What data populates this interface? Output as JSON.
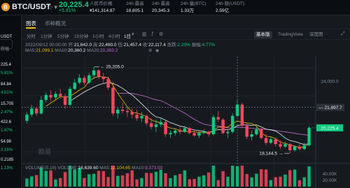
{
  "header": {
    "pair": "BTC/USDT",
    "pair_icon": "B",
    "price": "20,225.4",
    "change": "+5.81%",
    "stats": [
      {
        "label": "人民币价格",
        "value": "¥141,314.87"
      },
      {
        "label": "24h 最高",
        "value": "18,805.1"
      },
      {
        "label": "24h 最高",
        "value": "20,345.3"
      },
      {
        "label": "24h 量(BTC)",
        "value": "1.33万"
      },
      {
        "label": "24h 额(USDT)",
        "value": "2.59亿"
      }
    ]
  },
  "left_panel": {
    "items": [
      {
        "text": "USDT",
        "color": "#eaecef"
      },
      {
        "text": "跌幅",
        "color": "#848e9c"
      },
      {
        "text": "225.4",
        "color": "#eaecef"
      },
      {
        "text": "5.81%",
        "color": "#0ecb81"
      },
      {
        "text": "84.84",
        "color": "#eaecef"
      },
      {
        "text": "4.51%",
        "color": "#0ecb81"
      },
      {
        "text": "15.705",
        "color": "#eaecef"
      },
      {
        "text": "2.47%",
        "color": "#0ecb81"
      },
      {
        "text": "422.6",
        "color": "#eaecef"
      },
      {
        "text": "1.87%",
        "color": "#0ecb81"
      },
      {
        "text": "54.98",
        "color": "#eaecef"
      },
      {
        "text": "2.15%",
        "color": "#0ecb81"
      },
      {
        "text": "0.2185",
        "color": "#eaecef"
      },
      {
        "text": "1.13%",
        "color": "#0ecb81"
      }
    ]
  },
  "tabs": {
    "chart": "图表",
    "overview": "币种概况"
  },
  "toolbar": {
    "intervals": [
      "分时",
      "1分钟",
      "5分钟",
      "15分钟",
      "1小时",
      "4小时",
      "1日"
    ],
    "selected": "1日",
    "views": [
      "基本版",
      "TradingView",
      "深度图"
    ],
    "selected_view": "基本版"
  },
  "ohlc": {
    "date": "2022/09/12 00:00:00",
    "open_label": "开:",
    "open": "21,642.0",
    "high_label": "高:",
    "high": "22,490.0",
    "low_label": "低:",
    "low": "21,457.4",
    "close_label": "收:",
    "close": "22,117.4",
    "change_label": "涨跌:",
    "change": "2.20%",
    "amp_label": "振幅:",
    "amp": "4.77%"
  },
  "ma": {
    "ma5_label": "MA5:",
    "ma5": "21,099.1",
    "ma10_label": "MA10:",
    "ma10": "20,360.2",
    "ma20_label": "MA20:",
    "ma20": "20,393.2"
  },
  "volume_info": {
    "label": "VOLUME(5,10)",
    "vol_label": "VOLUME:",
    "vol": "16,639.60",
    "ma5_label": "MA5:",
    "ma5": "12,104.65",
    "ma10_label": "MA10:",
    "ma10": "9,373.50"
  },
  "price_axis": {
    "top": "24,000.0",
    "cross": "21,897.7",
    "current": "20,225.4",
    "vol1": "40.00K",
    "vol2": "20.00K"
  },
  "annotations": {
    "high": "25,205.0",
    "low": "18,144.5"
  },
  "watermark": "欧易",
  "colors": {
    "up": "#0ecb81",
    "down": "#f6465d",
    "ma5": "#f0b90b",
    "ma10": "#eaecef",
    "ma20": "#c86ad8"
  },
  "chart_data": {
    "type": "candlestick",
    "candles": [
      [
        20800,
        21500,
        20600,
        21300
      ],
      [
        21300,
        22100,
        21100,
        21800
      ],
      [
        21800,
        21900,
        21200,
        21400
      ],
      [
        21400,
        22800,
        21300,
        22500
      ],
      [
        22500,
        23100,
        22300,
        22900
      ],
      [
        22900,
        23300,
        22400,
        22700
      ],
      [
        22700,
        23200,
        22500,
        23000
      ],
      [
        23000,
        23400,
        22600,
        22800
      ],
      [
        22800,
        23000,
        21800,
        22100
      ],
      [
        22100,
        23600,
        22000,
        23400
      ],
      [
        23400,
        24200,
        23300,
        23900
      ],
      [
        23900,
        24600,
        23800,
        24300
      ],
      [
        24300,
        24500,
        23700,
        23900
      ],
      [
        23900,
        24700,
        23800,
        24500
      ],
      [
        24500,
        25205,
        24200,
        24900
      ],
      [
        24900,
        25000,
        24200,
        24400
      ],
      [
        24400,
        24700,
        23900,
        24200
      ],
      [
        24200,
        24400,
        23300,
        23500
      ],
      [
        23500,
        24000,
        21200,
        21400
      ],
      [
        21400,
        21900,
        21000,
        21700
      ],
      [
        21700,
        22300,
        21400,
        21600
      ],
      [
        21600,
        21900,
        21100,
        21500
      ],
      [
        21500,
        21800,
        21000,
        21300
      ],
      [
        21300,
        21700,
        20800,
        21000
      ],
      [
        21000,
        21500,
        20700,
        21200
      ],
      [
        21200,
        21300,
        20400,
        20600
      ],
      [
        20600,
        21000,
        20100,
        20300
      ],
      [
        20300,
        20900,
        19900,
        20500
      ],
      [
        20500,
        21000,
        20300,
        20700
      ],
      [
        20700,
        20800,
        19500,
        19700
      ],
      [
        19700,
        20000,
        19400,
        19800
      ],
      [
        19800,
        20200,
        19600,
        20000
      ],
      [
        20000,
        20300,
        19700,
        19900
      ],
      [
        19900,
        20400,
        19800,
        20200
      ],
      [
        20200,
        20300,
        19700,
        19800
      ],
      [
        19800,
        20100,
        19500,
        19600
      ],
      [
        19600,
        20000,
        19400,
        19800
      ],
      [
        19800,
        20100,
        19700,
        19900
      ],
      [
        19900,
        20000,
        19500,
        19700
      ],
      [
        19700,
        21300,
        19600,
        21100
      ],
      [
        21100,
        21600,
        20700,
        20900
      ],
      [
        20900,
        21000,
        19700,
        19800
      ],
      [
        19800,
        20100,
        19400,
        19900
      ],
      [
        19900,
        21400,
        19800,
        21200
      ],
      [
        21200,
        22490,
        21100,
        22117
      ],
      [
        22117,
        22300,
        20200,
        20400
      ],
      [
        20400,
        20600,
        19300,
        19500
      ],
      [
        19500,
        20000,
        19200,
        19700
      ],
      [
        19700,
        20300,
        19600,
        20100
      ],
      [
        20100,
        20200,
        19300,
        19400
      ],
      [
        19400,
        19700,
        18800,
        19000
      ],
      [
        19000,
        19500,
        18900,
        19300
      ],
      [
        19300,
        19400,
        18700,
        18900
      ],
      [
        18900,
        19200,
        18500,
        18700
      ],
      [
        18700,
        19100,
        18600,
        18900
      ],
      [
        18900,
        19000,
        18144.5,
        18400
      ],
      [
        18400,
        18800,
        18300,
        18700
      ],
      [
        18700,
        18900,
        18400,
        18500
      ],
      [
        18500,
        19000,
        18400,
        18800
      ],
      [
        18800,
        20345,
        18700,
        20225
      ]
    ]
  }
}
